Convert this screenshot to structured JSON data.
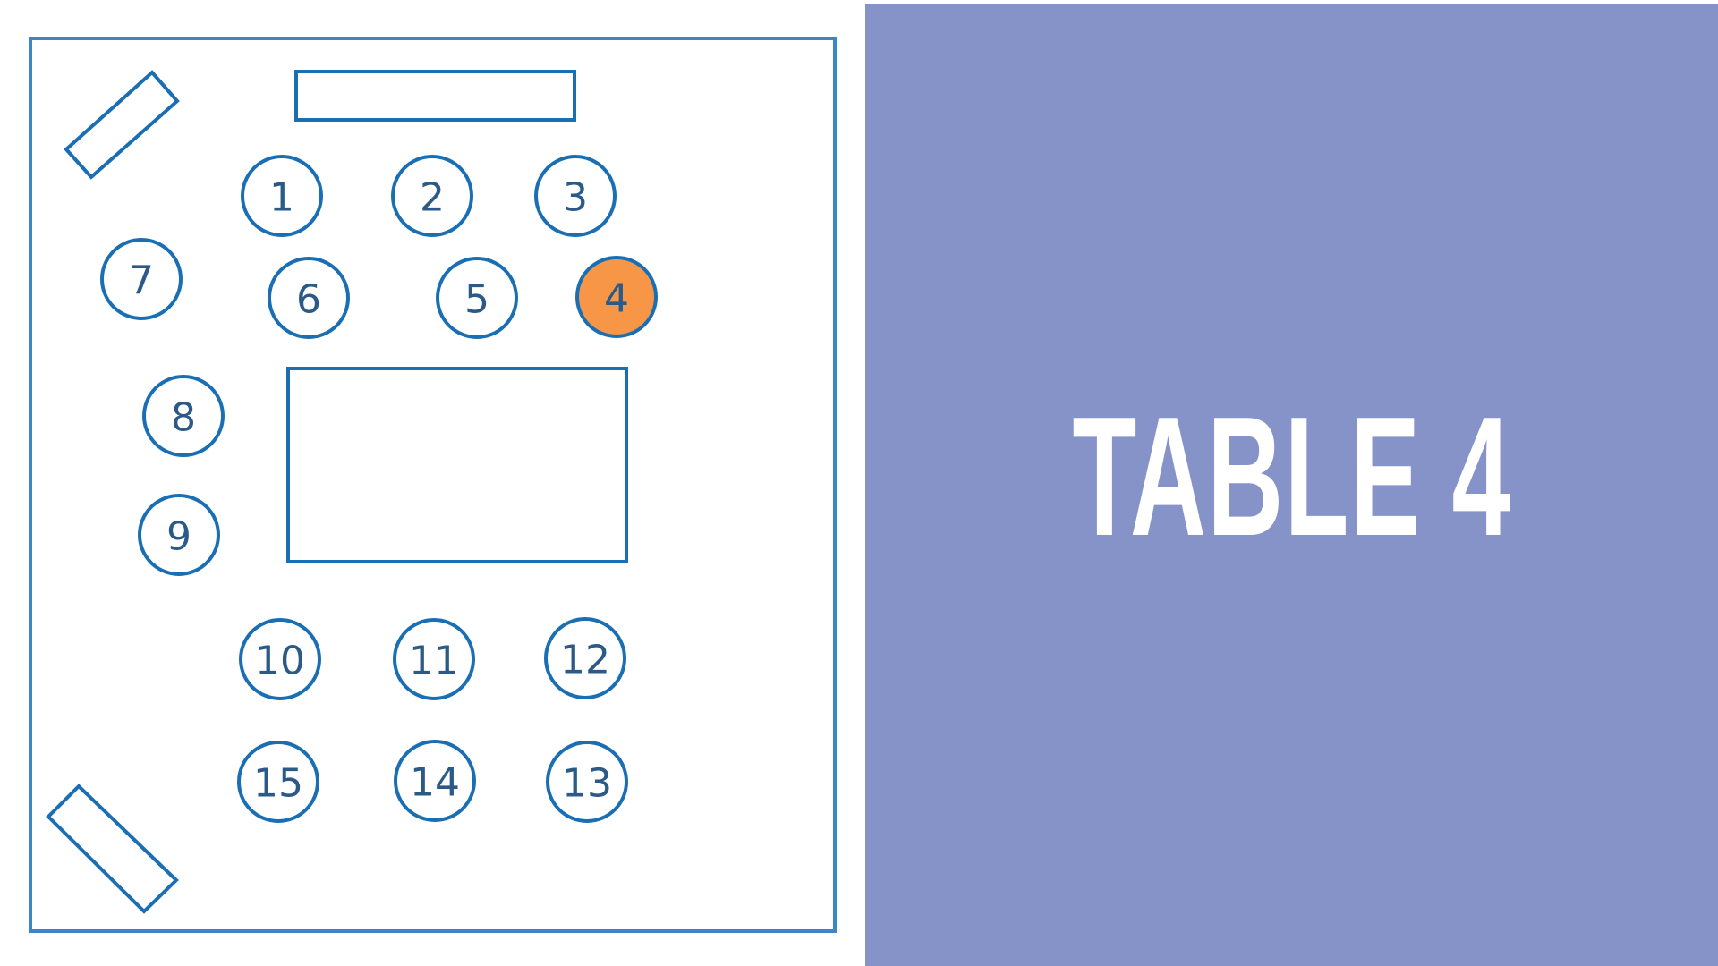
{
  "panel": {
    "title": "TABLE 4",
    "background_color": "#8593c8",
    "text_color": "#ffffff"
  },
  "floorplan": {
    "accent_color": "#1a6fb4",
    "highlight_color": "#f79646",
    "highlighted_table": "4",
    "tables": [
      "1",
      "2",
      "3",
      "4",
      "5",
      "6",
      "7",
      "8",
      "9",
      "10",
      "11",
      "12",
      "13",
      "14",
      "15"
    ]
  }
}
